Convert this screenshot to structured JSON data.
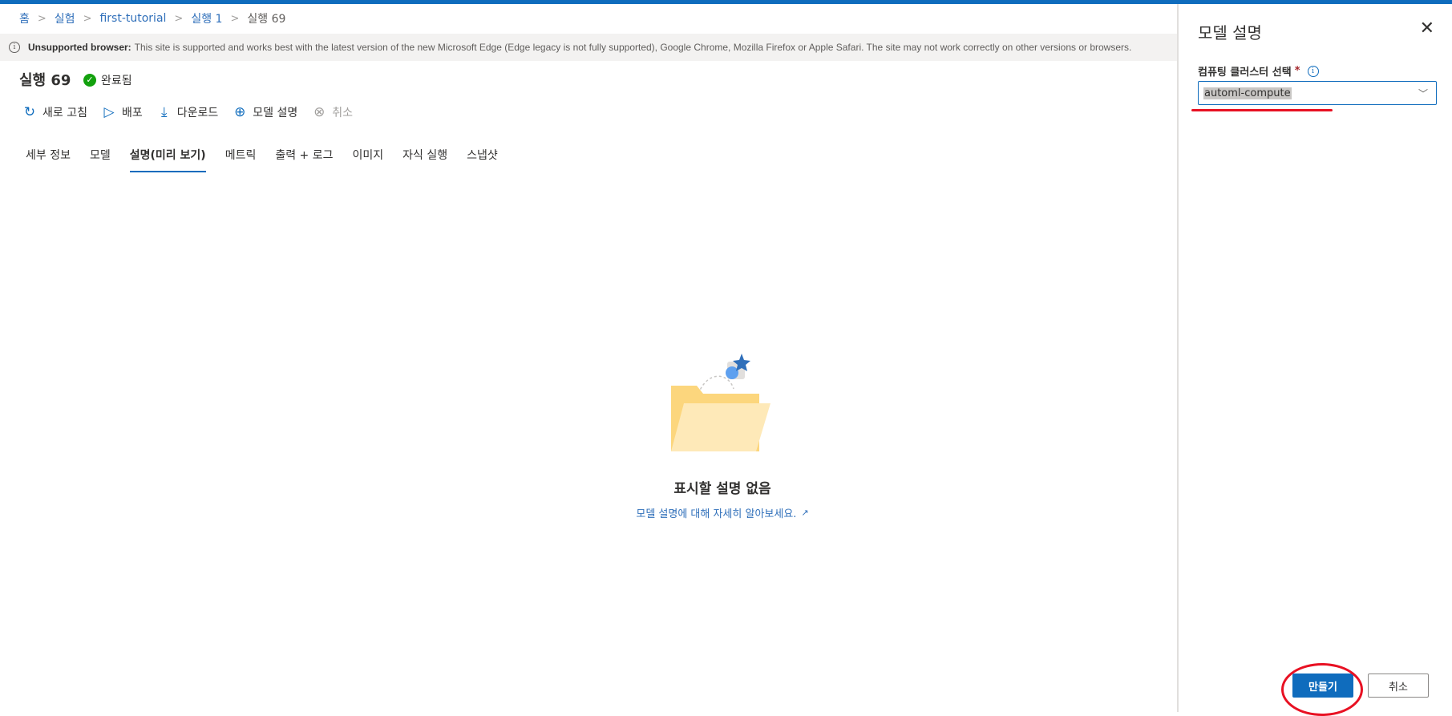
{
  "breadcrumb": [
    "홈",
    "실험",
    "first-tutorial",
    "실행 1",
    "실행 69"
  ],
  "banner": {
    "bold": "Unsupported browser:",
    "text": "This site is supported and works best with the latest version of the new Microsoft Edge (Edge legacy is not fully supported), Google Chrome, Mozilla Firefox or Apple Safari. The site may not work correctly on other versions or browsers."
  },
  "run": {
    "title": "실행 69",
    "status": "완료됨"
  },
  "toolbar": {
    "refresh": "새로 고침",
    "deploy": "배포",
    "download": "다운로드",
    "explain": "모델 설명",
    "cancel": "취소"
  },
  "tabs": [
    "세부 정보",
    "모델",
    "설명(미리 보기)",
    "메트릭",
    "출력 + 로그",
    "이미지",
    "자식 실행",
    "스냅샷"
  ],
  "active_tab": "설명(미리 보기)",
  "empty_state": {
    "title": "표시할 설명 없음",
    "link": "모델 설명에 대해 자세히 알아보세요."
  },
  "panel": {
    "title": "모델 설명",
    "field_label": "컴퓨팅 클러스터 선택",
    "required_mark": "*",
    "selected_value": "automl-compute",
    "create_label": "만들기",
    "cancel_label": "취소"
  },
  "colors": {
    "accent": "#0f6cbd",
    "success": "#13a10e",
    "annotation": "#e81123"
  }
}
